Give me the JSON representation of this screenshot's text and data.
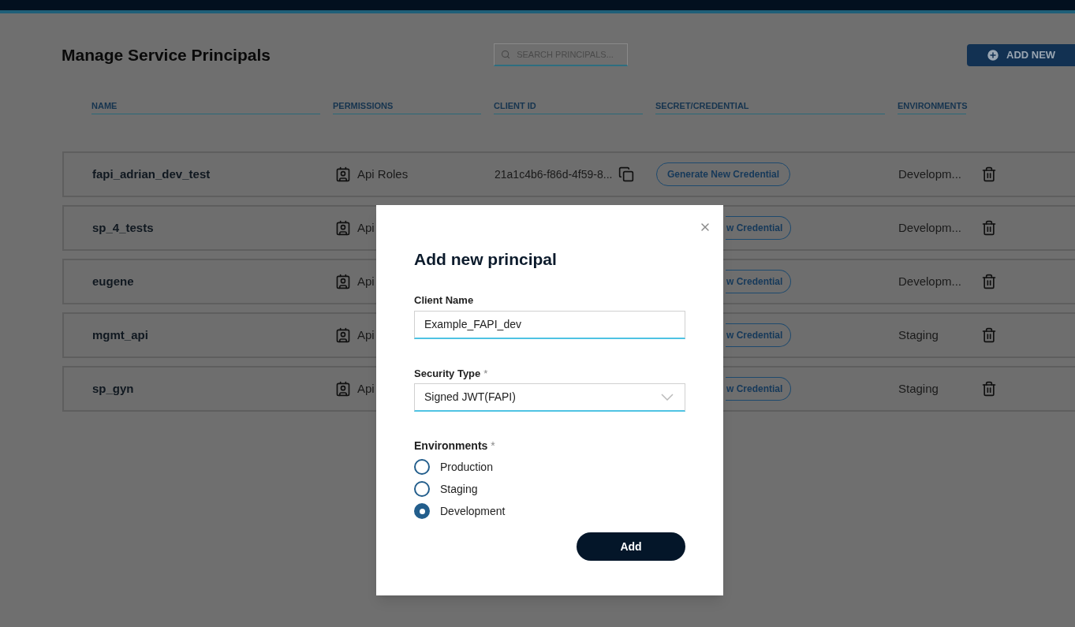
{
  "header": {
    "title": "Manage Service Principals",
    "search": {
      "placeholder": "SEARCH PRINCIPALS..."
    },
    "add_button": "ADD NEW"
  },
  "table": {
    "columns": [
      "NAME",
      "PERMISSIONS",
      "CLIENT ID",
      "SECRET/CREDENTIAL",
      "ENVIRONMENTS"
    ],
    "rows": [
      {
        "name": "fapi_adrian_dev_test",
        "permission": "Api Roles",
        "client_id": "21a1c4b6-f86d-4f59-8...",
        "credential_button": "Generate New Credential",
        "environment": "Developm..."
      },
      {
        "name": "sp_4_tests",
        "permission": "Api",
        "credential_button": "w Credential",
        "button_cut_off": true,
        "environment": "Developm..."
      },
      {
        "name": "eugene",
        "permission": "Api",
        "credential_button": "w Credential",
        "button_cut_off": true,
        "environment": "Developm..."
      },
      {
        "name": "mgmt_api",
        "permission": "Api",
        "credential_button": "w Credential",
        "button_cut_off": true,
        "environment": "Staging"
      },
      {
        "name": "sp_gyn",
        "permission": "Api",
        "credential_button": "w Credential",
        "button_cut_off": true,
        "environment": "Staging"
      }
    ]
  },
  "dialog": {
    "title": "Add new principal",
    "client_name": {
      "label": "Client Name",
      "value": "Example_FAPI_dev"
    },
    "security_type": {
      "label": "Security Type",
      "required_mark": "*",
      "value": "Signed JWT(FAPI)"
    },
    "environments": {
      "label": "Environments",
      "required_mark": "*",
      "options": [
        {
          "label": "Production",
          "selected": false
        },
        {
          "label": "Staging",
          "selected": false
        },
        {
          "label": "Development",
          "selected": true
        }
      ]
    },
    "submit_button": "Add"
  }
}
